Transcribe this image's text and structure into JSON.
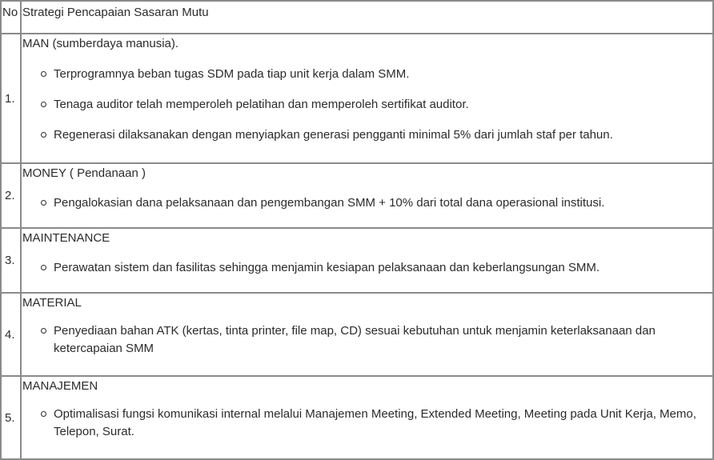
{
  "table": {
    "header": {
      "no": "No",
      "strategy": "Strategi Pencapaian Sasaran Mutu"
    },
    "rows": [
      {
        "no": "1.",
        "category": "MAN (sumberdaya manusia).",
        "items": [
          "Terprogramnya beban tugas SDM pada tiap unit kerja dalam SMM.",
          "Tenaga auditor telah memperoleh pelatihan dan memperoleh sertifikat auditor.",
          "Regenerasi dilaksanakan dengan menyiapkan generasi pengganti minimal 5% dari jumlah staf per tahun."
        ]
      },
      {
        "no": "2.",
        "category": "MONEY ( Pendanaan )",
        "items": [
          "Pengalokasian dana pelaksanaan dan pengembangan SMM + 10% dari total dana operasional institusi."
        ]
      },
      {
        "no": "3.",
        "category": "MAINTENANCE",
        "items": [
          "Perawatan sistem dan fasilitas sehingga menjamin kesiapan pelaksanaan dan keberlangsungan SMM."
        ]
      },
      {
        "no": "4.",
        "category": "MATERIAL",
        "items": [
          "Penyediaan bahan ATK (kertas, tinta printer, file map, CD) sesuai kebutuhan untuk menjamin keterlaksanaan dan ketercapaian SMM"
        ]
      },
      {
        "no": "5.",
        "category": "MANAJEMEN",
        "items": [
          "Optimalisasi fungsi komunikasi internal melalui Manajemen Meeting, Extended Meeting, Meeting pada Unit Kerja, Memo, Telepon, Surat."
        ]
      }
    ]
  }
}
